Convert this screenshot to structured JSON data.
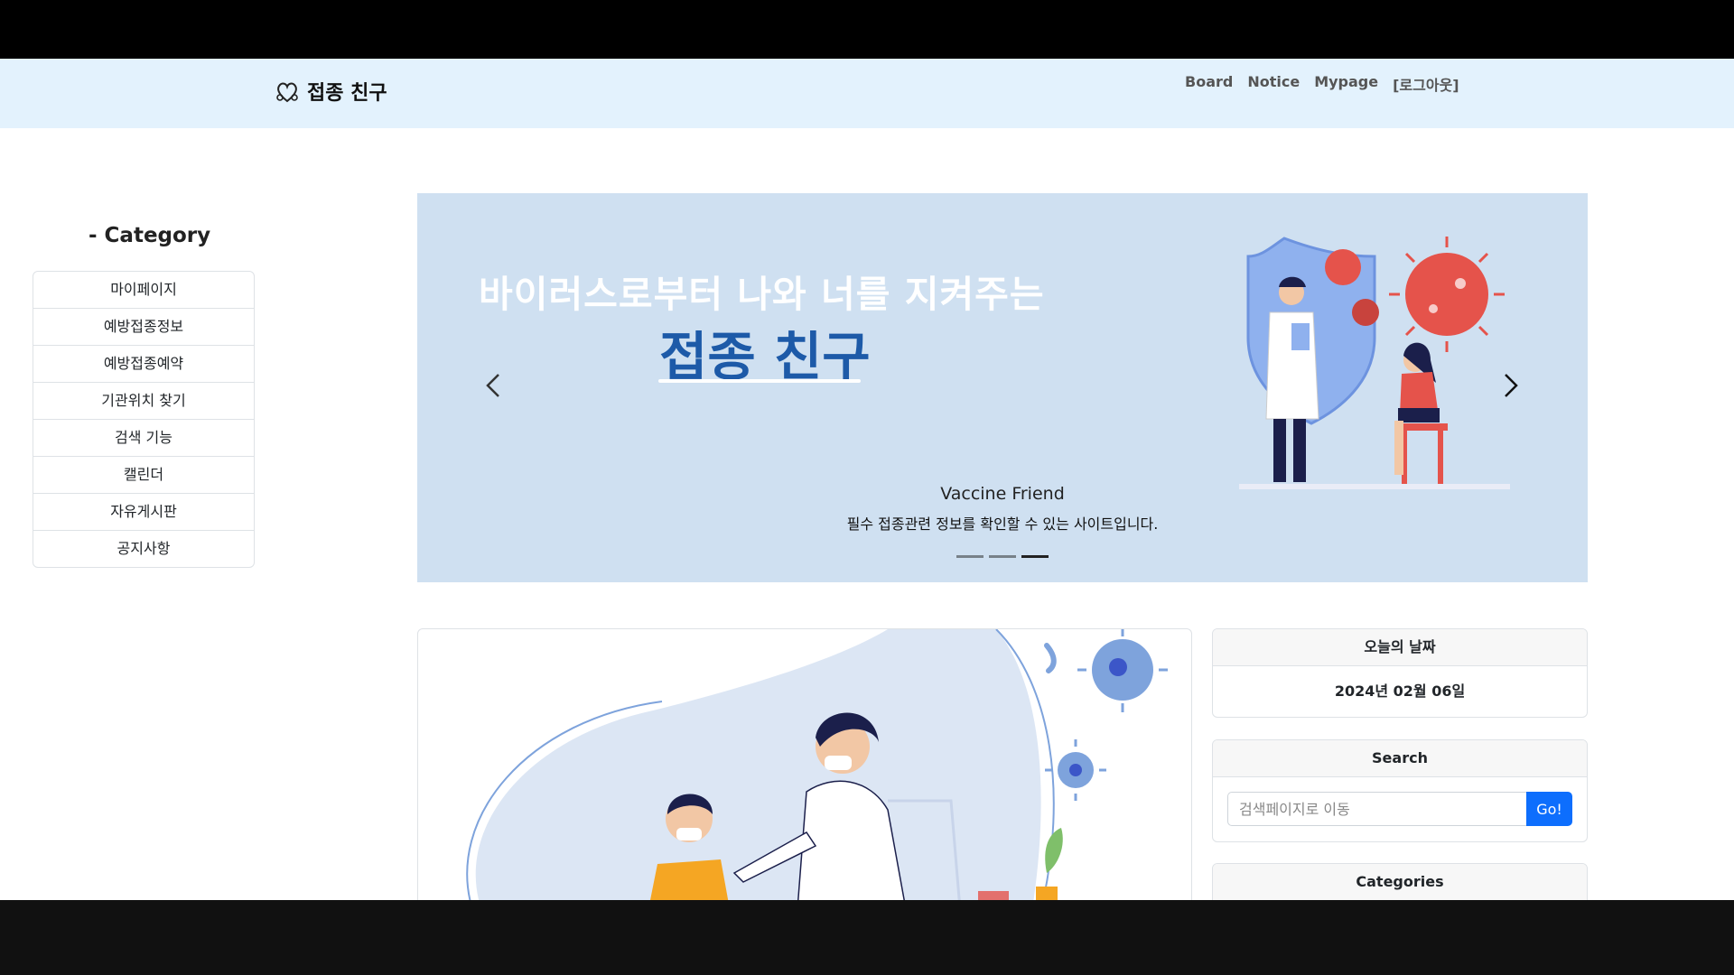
{
  "brand": {
    "name": "접종 친구"
  },
  "nav": [
    "Board",
    "Notice",
    "Mypage",
    "[로그아웃]"
  ],
  "sidebar": {
    "title": "- Category",
    "items": [
      "마이페이지",
      "예방접종정보",
      "예방접종예약",
      "기관위치 찾기",
      "검색 기능",
      "캘린더",
      "자유게시판",
      "공지사항"
    ]
  },
  "carousel": {
    "headline": "바이러스로부터 나와 너를 지켜주는",
    "headline_emphasis": "접종 친구",
    "caption_title": "Vaccine Friend",
    "caption_text": "필수 접종관련 정보를 확인할 수 있는 사이트입니다.",
    "slides": 3,
    "active_slide": 3
  },
  "today_card": {
    "title": "오늘의 날짜",
    "date": "2024년 02월 06일"
  },
  "search_card": {
    "title": "Search",
    "placeholder": "검색페이지로 이동",
    "button": "Go!"
  },
  "categories_card": {
    "title": "Categories"
  },
  "colors": {
    "navbar": "#e3f2fd",
    "accent": "#0d6efd",
    "hero_bg": "#cfe0f1",
    "hero_text": "#1d5aa8",
    "virus": "#e5534b"
  }
}
